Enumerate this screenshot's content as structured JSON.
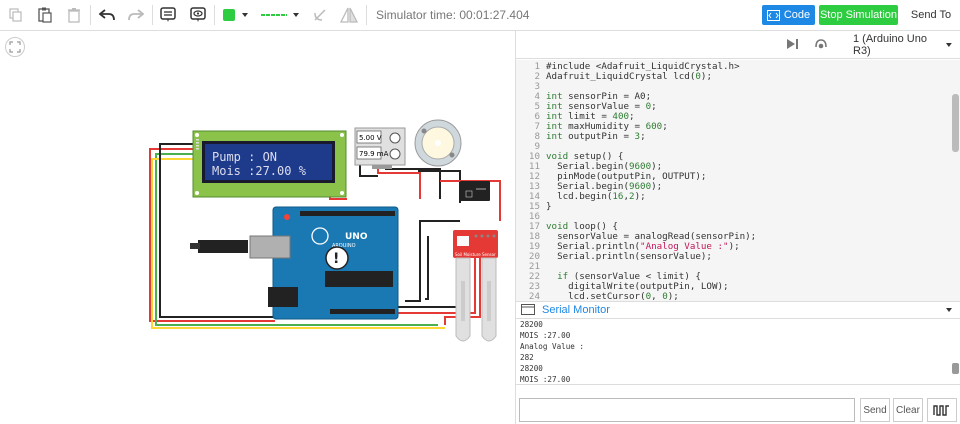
{
  "toolbar": {
    "sim_time": "Simulator time: 00:01:27.404",
    "code_label": "Code",
    "stop_label": "Stop Simulation",
    "send_label": "Send To",
    "accent": "#1e88e5",
    "stop_color": "#2ecc40",
    "fill_color": "#2ecc40"
  },
  "circuit": {
    "lcd_line1": "Pump : ON",
    "lcd_line2": "Mois :27.00 %",
    "power_voltage": "5.00 V",
    "power_current": "79.9 mA",
    "arduino_label": "UNO",
    "arduino_sub": "ARDUINO",
    "sensor_label": "Soil Moisture Sensor",
    "warning_symbol": "!"
  },
  "code_panel": {
    "board": "1 (Arduino Uno R3)",
    "lines": [
      "#include <Adafruit_LiquidCrystal.h>",
      "Adafruit_LiquidCrystal lcd(0);",
      "",
      "int sensorPin = A0;",
      "int sensorValue = 0;",
      "int limit = 400;",
      "int maxHumidity = 600;",
      "int outputPin = 3;",
      "",
      "void setup() {",
      "  Serial.begin(9600);",
      "  pinMode(outputPin, OUTPUT);",
      "  Serial.begin(9600);",
      "  lcd.begin(16,2);",
      "}",
      "",
      "void loop() {",
      "  sensorValue = analogRead(sensorPin);",
      "  Serial.println(\"Analog Value :\");",
      "  Serial.println(sensorValue);",
      "",
      "  if (sensorValue < limit) {",
      "    digitalWrite(outputPin, LOW);",
      "    lcd.setCursor(0, 0);"
    ]
  },
  "serial": {
    "title": "Serial Monitor",
    "output": [
      "28200",
      "MOIS :27.00",
      "Analog Value :",
      "282",
      "28200",
      "MOIS :27.00"
    ],
    "input_placeholder": "",
    "send_label": "Send",
    "clear_label": "Clear"
  }
}
